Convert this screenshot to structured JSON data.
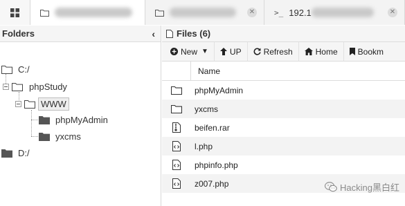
{
  "tabs": [
    {
      "label": "",
      "active": true
    },
    {
      "label": "",
      "active": false
    },
    {
      "label": "192.1",
      "active": false,
      "icon": "terminal-icon"
    }
  ],
  "folders": {
    "title": "Folders",
    "tree": {
      "c_drive": "C:/",
      "phpstudy": "phpStudy",
      "www": "WWW",
      "phpmyadmin": "phpMyAdmin",
      "yxcms": "yxcms",
      "d_drive": "D:/"
    }
  },
  "files": {
    "title": "Files (6)",
    "toolbar": {
      "new_label": "New",
      "up_label": "UP",
      "refresh_label": "Refresh",
      "home_label": "Home",
      "bookmark_label": "Bookm"
    },
    "column_name": "Name",
    "rows": [
      {
        "name": "phpMyAdmin",
        "type": "folder"
      },
      {
        "name": "yxcms",
        "type": "folder"
      },
      {
        "name": "beifen.rar",
        "type": "archive"
      },
      {
        "name": "l.php",
        "type": "code"
      },
      {
        "name": "phpinfo.php",
        "type": "code"
      },
      {
        "name": "z007.php",
        "type": "code"
      }
    ]
  },
  "watermark": "Hacking黑白红",
  "colors": {
    "accent": "#333333",
    "row_stripe": "#f3f3f3",
    "panel_head": "#f5f5f5"
  }
}
